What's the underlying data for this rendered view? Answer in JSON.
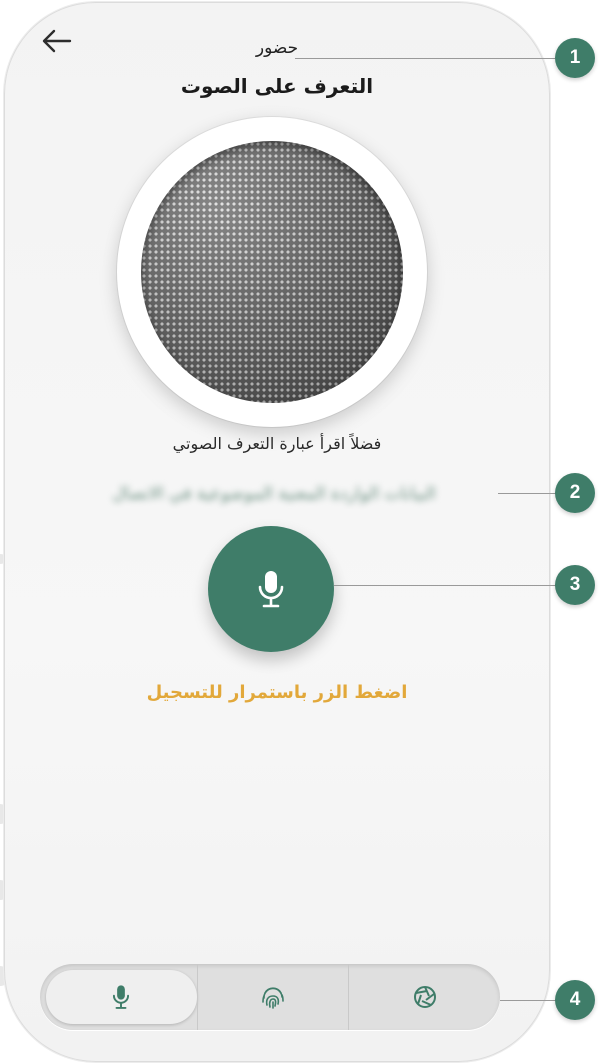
{
  "header": {
    "back_icon": "arrow-left-icon",
    "subtitle": "حضور",
    "title": "التعرف على الصوت"
  },
  "speaker": {
    "icon": "speaker-grill"
  },
  "instruction": "فضلاً اقرأ عبارة التعرف الصوتي",
  "phrase_blurred": "البيانات الواردة المعنية الموضوعية في الاتصال",
  "record_button": {
    "icon": "microphone-icon"
  },
  "hint": "اضغط الزر باستمرار للتسجيل",
  "method_selector": {
    "options": [
      {
        "icon": "microphone-icon",
        "selected": true
      },
      {
        "icon": "fingerprint-icon",
        "selected": false
      },
      {
        "icon": "camera-aperture-icon",
        "selected": false
      }
    ]
  },
  "callouts": [
    "1",
    "2",
    "3",
    "4"
  ],
  "colors": {
    "brand_green": "#3f7d69",
    "hint_orange": "#e2a83a",
    "background": "#f4f4f4"
  }
}
